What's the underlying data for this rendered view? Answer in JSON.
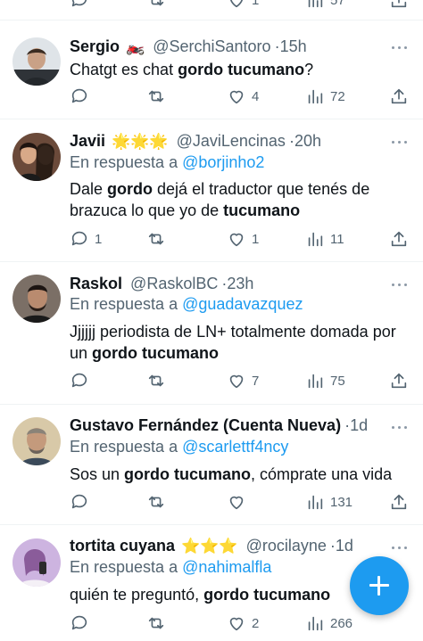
{
  "top_actions": {
    "likes": "1",
    "views": "57"
  },
  "tweets": [
    {
      "name": "Sergio",
      "name_emoji": "🏍️",
      "handle": "@SerchiSantoro",
      "time": "15h",
      "reply_to_prefix": "",
      "reply_to_handle": "",
      "text_line1": [
        {
          "t": "Chatgt es chat ",
          "b": false
        },
        {
          "t": "gordo tucumano",
          "b": true
        },
        {
          "t": "?",
          "b": false
        }
      ],
      "text_line2": [],
      "replies": "",
      "retweets": "",
      "likes": "4",
      "views": "72"
    },
    {
      "name": "Javii",
      "name_emoji": "🌟🌟🌟",
      "handle": "@JaviLencinas",
      "time": "20h",
      "reply_to_prefix": "En respuesta a ",
      "reply_to_handle": "@borjinho2",
      "text_line1": [
        {
          "t": "Dale ",
          "b": false
        },
        {
          "t": "gordo",
          "b": true
        },
        {
          "t": " dejá el traductor que tenés de",
          "b": false
        }
      ],
      "text_line2": [
        {
          "t": "brazuca lo que yo de ",
          "b": false
        },
        {
          "t": "tucumano",
          "b": true
        }
      ],
      "replies": "1",
      "retweets": "",
      "likes": "1",
      "views": "11"
    },
    {
      "name": "Raskol",
      "name_emoji": "",
      "handle": "@RaskolBC",
      "time": "23h",
      "reply_to_prefix": "En respuesta a ",
      "reply_to_handle": "@guadavazquez",
      "text_line1": [
        {
          "t": "Jjjjjj periodista de LN+ totalmente domada por",
          "b": false
        }
      ],
      "text_line2": [
        {
          "t": "un ",
          "b": false
        },
        {
          "t": "gordo tucumano",
          "b": true
        }
      ],
      "replies": "",
      "retweets": "",
      "likes": "7",
      "views": "75"
    },
    {
      "name": "Gustavo Fernández (Cuenta Nueva)",
      "name_emoji": "",
      "handle": "",
      "time": "1d",
      "reply_to_prefix": "En respuesta a ",
      "reply_to_handle": "@scarlettf4ncy",
      "text_line1": [
        {
          "t": "Sos un ",
          "b": false
        },
        {
          "t": "gordo tucumano",
          "b": true
        },
        {
          "t": ", cómprate una vida",
          "b": false
        }
      ],
      "text_line2": [],
      "replies": "",
      "retweets": "",
      "likes": "",
      "views": "131"
    },
    {
      "name": "tortita cuyana",
      "name_emoji": "⭐⭐⭐",
      "handle": "@rocilayne",
      "time": "1d",
      "reply_to_prefix": "En respuesta a ",
      "reply_to_handle": "@nahimalfla",
      "text_line1": [
        {
          "t": "quién te preguntó, ",
          "b": false
        },
        {
          "t": "gordo tucumano",
          "b": true
        }
      ],
      "text_line2": [],
      "replies": "",
      "retweets": "",
      "likes": "2",
      "views": "266"
    }
  ],
  "colors": {
    "accent": "#1d9bf0",
    "secondary_text": "#536471",
    "primary_text": "#0f1419",
    "divider": "#eff3f4"
  },
  "icons": [
    "reply-icon",
    "retweet-icon",
    "like-icon",
    "views-icon",
    "share-icon",
    "more-icon",
    "compose-plus-icon"
  ]
}
